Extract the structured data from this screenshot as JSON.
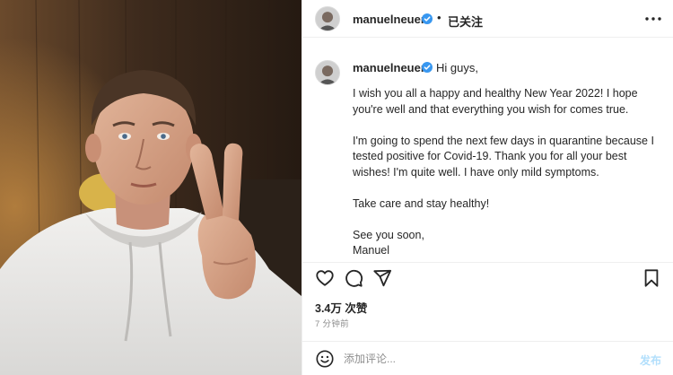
{
  "post": {
    "username": "manuelneuer",
    "verified": true,
    "dot": "•",
    "follow_status": "已关注",
    "more_icon": "more-horizontal-icon"
  },
  "caption": {
    "username": "manuelneuer",
    "greeting": "Hi guys,",
    "paragraph1": "I wish you all a happy and healthy New Year 2022! I hope you're well and that everything you wish for comes true.",
    "paragraph2": "I'm going to spend the next few days in quarantine because I tested positive for Covid-19. Thank you for all your best wishes! I'm quite well. I have only mild symptoms.",
    "paragraph3": "Take care and stay healthy!",
    "signoff_line1": "See you soon,",
    "signoff_line2": "Manuel"
  },
  "actions": {
    "like_icon": "heart-icon",
    "comment_icon": "comment-icon",
    "share_icon": "send-icon",
    "save_icon": "bookmark-icon"
  },
  "stats": {
    "likes": "3.4万 次赞",
    "time_ago": "7 分钟前"
  },
  "comment": {
    "emoji_icon": "smiley-icon",
    "placeholder": "添加评论...",
    "publish_label": "发布"
  },
  "colors": {
    "verified": "#3897f0",
    "publish_disabled": "#b2dffc",
    "secondary_text": "#8e8e8e",
    "border": "#efefef"
  }
}
